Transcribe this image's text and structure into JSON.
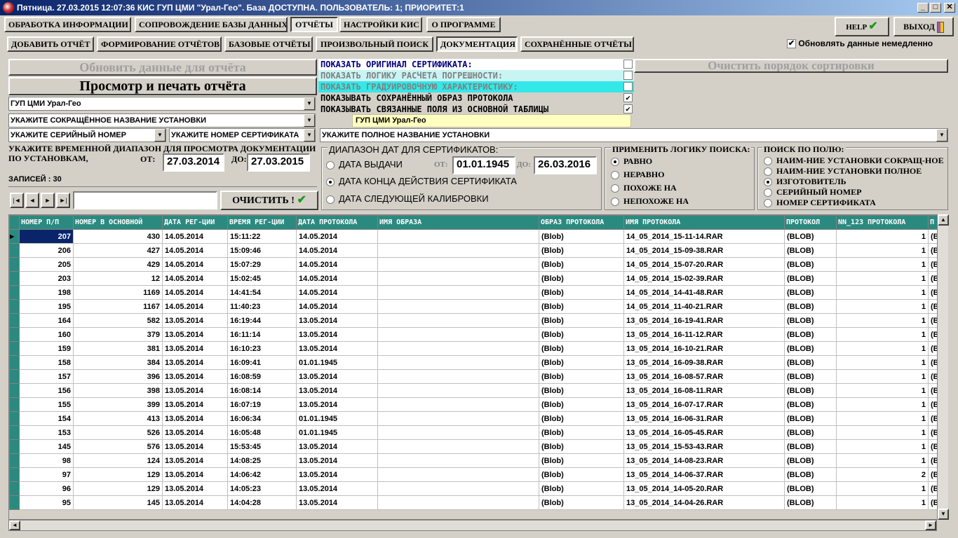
{
  "window": {
    "title": "Пятница. 27.03.2015 12:07:36 КИС ГУП ЦМИ \"Урал-Гео\". База ДОСТУПНА. ПОЛЬЗОВАТЕЛЬ: 1; ПРИОРИТЕТ:1",
    "min": "_",
    "max": "□",
    "close": "✕"
  },
  "menu_tabs": [
    "ОБРАБОТКА ИНФОРМАЦИИ",
    "СОПРОВОЖДЕНИЕ БАЗЫ ДАННЫХ",
    "ОТЧЁТЫ",
    "НАСТРОЙКИ КИС",
    "О ПРОГРАММЕ"
  ],
  "sub_tabs": [
    "ДОБАВИТЬ ОТЧЁТ",
    "ФОРМИРОВАНИЕ ОТЧЁТОВ",
    "БАЗОВЫЕ ОТЧЁТЫ",
    "ПРОИЗВОЛЬНЫЙ ПОИСК",
    "ДОКУМЕНТАЦИЯ",
    "СОХРАНЁННЫЕ ОТЧЁТЫ"
  ],
  "help_label": "HELP",
  "exit_label": "ВЫХОД",
  "auto_refresh": {
    "label": "Обновлять данные немедленно",
    "checked": true
  },
  "refresh_button": "Обновить данные для отчёта",
  "view_print_button": "Просмотр и печать отчёта",
  "clear_sort_button": "Очистить порядок сортировки",
  "combos": {
    "org": "ГУП ЦМИ Урал-Гео",
    "short_name": "УКАЖИТЕ СОКРАЩЁННОЕ НАЗВАНИЕ УСТАНОВКИ",
    "serial": "УКАЖИТЕ СЕРИЙНЫЙ НОМЕР",
    "cert_no": "УКАЖИТЕ НОМЕР СЕРТИФИКАТА",
    "full_name": "УКАЖИТЕ ПОЛНОЕ НАЗВАНИЕ УСТАНОВКИ"
  },
  "options": [
    {
      "label": "ПОКАЗАТЬ ОРИГИНАЛ СЕРТИФИКАТА:",
      "bg": "#ffffff",
      "color": "#000080",
      "checked": false
    },
    {
      "label": "ПОКАЗАТЬ ЛОГИКУ РАСЧЕТА ПОГРЕШНОСТИ:",
      "bg": "#c8f4f4",
      "color": "#808080",
      "checked": false
    },
    {
      "label": "ПОКАЗАТЬ ГРАДУИРОВОЧНУЮ ХАРАКТЕРИСТИКУ:",
      "bg": "#33e8e8",
      "color": "#808080",
      "checked": false
    },
    {
      "label": "ПОКАЗЫВАТЬ СОХРАНЁННЫЙ ОБРАЗ ПРОТОКОЛА",
      "bg": "#d4d0c8",
      "color": "#000000",
      "checked": true
    },
    {
      "label": "ПОКАЗЫВАТЬ СВЯЗАННЫЕ ПОЛЯ ИЗ ОСНОВНОЙ ТАБЛИЦЫ",
      "bg": "#d4d0c8",
      "color": "#000000",
      "checked": true
    }
  ],
  "org_highlight": "ГУП ЦМИ Урал-Гео",
  "time_range": {
    "label": "УКАЖИТЕ ВРЕМЕННОЙ ДИАПАЗОН ДЛЯ ПРОСМОТРА ДОКУМЕНТАЦИИ ПО УСТАНОВКАМ,",
    "from_label": "ОТ:",
    "from": "27.03.2014",
    "to_label": "ДО:",
    "to": "27.03.2015"
  },
  "records": "ЗАПИСЕЙ : 30",
  "clear_button": "ОЧИСТИТЬ !",
  "cert_dates": {
    "title": "ДИАПАЗОН ДАТ ДЛЯ СЕРТИФИКАТОВ:",
    "options": [
      "ДАТА ВЫДАЧИ",
      "ДАТА КОНЦА ДЕЙСТВИЯ СЕРТИФИКАТА",
      "ДАТА СЛЕДУЮЩЕЙ КАЛИБРОВКИ"
    ],
    "selected": 1,
    "from_label": "ОТ:",
    "from": "01.01.1945",
    "to_label": "ДО:",
    "to": "26.03.2016"
  },
  "search_logic": {
    "title": "ПРИМЕНИТЬ ЛОГИКУ ПОИСКА:",
    "options": [
      "РАВНО",
      "НЕРАВНО",
      "ПОХОЖЕ НА",
      "НЕПОХОЖЕ НА"
    ],
    "selected": 0
  },
  "search_field": {
    "title": "ПОИСК ПО ПОЛЮ:",
    "options": [
      "НАИМ-НИЕ УСТАНОВКИ СОКРАЩ-НОЕ",
      "НАИМ-НИЕ УСТАНОВКИ ПОЛНОЕ",
      "ИЗГОТОВИТЕЛЬ",
      "СЕРИЙНЫЙ НОМЕР",
      "НОМЕР СЕРТИФИКАТА"
    ],
    "selected": 2
  },
  "nav": {
    "first": "|◄",
    "prev": "◄",
    "next": "►",
    "last": "►|"
  },
  "grid": {
    "columns": [
      "НОМЕР П/П",
      "НОМЕР В ОСНОВНОЙ",
      "ДАТА РЕГ-ЦИИ",
      "ВРЕМЯ РЕГ-ЦИИ",
      "ДАТА ПРОТОКОЛА",
      "ИМЯ ОБРАЗА",
      "ОБРАЗ ПРОТОКОЛА",
      "ИМЯ ПРОТОКОЛА",
      "ПРОТОКОЛ",
      "NN_123 ПРОТОКОЛА",
      "П"
    ],
    "rows": [
      [
        "207",
        "430",
        "14.05.2014",
        "15:11:22",
        "14.05.2014",
        "",
        "(Blob)",
        "14_05_2014_15-11-14.RAR",
        "(BLOB)",
        "1",
        "(B"
      ],
      [
        "206",
        "427",
        "14.05.2014",
        "15:09:46",
        "14.05.2014",
        "",
        "(Blob)",
        "14_05_2014_15-09-38.RAR",
        "(BLOB)",
        "1",
        "(B"
      ],
      [
        "205",
        "429",
        "14.05.2014",
        "15:07:29",
        "14.05.2014",
        "",
        "(Blob)",
        "14_05_2014_15-07-20.RAR",
        "(BLOB)",
        "1",
        "(B"
      ],
      [
        "203",
        "12",
        "14.05.2014",
        "15:02:45",
        "14.05.2014",
        "",
        "(Blob)",
        "14_05_2014_15-02-39.RAR",
        "(BLOB)",
        "1",
        "(B"
      ],
      [
        "198",
        "1169",
        "14.05.2014",
        "14:41:54",
        "14.05.2014",
        "",
        "(Blob)",
        "14_05_2014_14-41-48.RAR",
        "(BLOB)",
        "1",
        "(B"
      ],
      [
        "195",
        "1167",
        "14.05.2014",
        "11:40:23",
        "14.05.2014",
        "",
        "(Blob)",
        "14_05_2014_11-40-21.RAR",
        "(BLOB)",
        "1",
        "(B"
      ],
      [
        "164",
        "582",
        "13.05.2014",
        "16:19:44",
        "13.05.2014",
        "",
        "(Blob)",
        "13_05_2014_16-19-41.RAR",
        "(BLOB)",
        "1",
        "(B"
      ],
      [
        "160",
        "379",
        "13.05.2014",
        "16:11:14",
        "13.05.2014",
        "",
        "(Blob)",
        "13_05_2014_16-11-12.RAR",
        "(BLOB)",
        "1",
        "(B"
      ],
      [
        "159",
        "381",
        "13.05.2014",
        "16:10:23",
        "13.05.2014",
        "",
        "(Blob)",
        "13_05_2014_16-10-21.RAR",
        "(BLOB)",
        "1",
        "(B"
      ],
      [
        "158",
        "384",
        "13.05.2014",
        "16:09:41",
        "01.01.1945",
        "",
        "(Blob)",
        "13_05_2014_16-09-38.RAR",
        "(BLOB)",
        "1",
        "(B"
      ],
      [
        "157",
        "396",
        "13.05.2014",
        "16:08:59",
        "13.05.2014",
        "",
        "(Blob)",
        "13_05_2014_16-08-57.RAR",
        "(BLOB)",
        "1",
        "(B"
      ],
      [
        "156",
        "398",
        "13.05.2014",
        "16:08:14",
        "13.05.2014",
        "",
        "(Blob)",
        "13_05_2014_16-08-11.RAR",
        "(BLOB)",
        "1",
        "(B"
      ],
      [
        "155",
        "399",
        "13.05.2014",
        "16:07:19",
        "13.05.2014",
        "",
        "(Blob)",
        "13_05_2014_16-07-17.RAR",
        "(BLOB)",
        "1",
        "(B"
      ],
      [
        "154",
        "413",
        "13.05.2014",
        "16:06:34",
        "01.01.1945",
        "",
        "(Blob)",
        "13_05_2014_16-06-31.RAR",
        "(BLOB)",
        "1",
        "(B"
      ],
      [
        "153",
        "526",
        "13.05.2014",
        "16:05:48",
        "01.01.1945",
        "",
        "(Blob)",
        "13_05_2014_16-05-45.RAR",
        "(BLOB)",
        "1",
        "(B"
      ],
      [
        "145",
        "576",
        "13.05.2014",
        "15:53:45",
        "13.05.2014",
        "",
        "(Blob)",
        "13_05_2014_15-53-43.RAR",
        "(BLOB)",
        "1",
        "(B"
      ],
      [
        "98",
        "124",
        "13.05.2014",
        "14:08:25",
        "13.05.2014",
        "",
        "(Blob)",
        "13_05_2014_14-08-23.RAR",
        "(BLOB)",
        "1",
        "(B"
      ],
      [
        "97",
        "129",
        "13.05.2014",
        "14:06:42",
        "13.05.2014",
        "",
        "(Blob)",
        "13_05_2014_14-06-37.RAR",
        "(BLOB)",
        "2",
        "(B"
      ],
      [
        "96",
        "129",
        "13.05.2014",
        "14:05:23",
        "13.05.2014",
        "",
        "(Blob)",
        "13_05_2014_14-05-20.RAR",
        "(BLOB)",
        "1",
        "(B"
      ],
      [
        "95",
        "145",
        "13.05.2014",
        "14:04:28",
        "13.05.2014",
        "",
        "(Blob)",
        "13_05_2014_14-04-26.RAR",
        "(BLOB)",
        "1",
        "(B"
      ]
    ]
  },
  "colors": {
    "grid_header": "#2b8a80",
    "title_bar": "#0a246a",
    "highlight": "#ffffc0"
  }
}
